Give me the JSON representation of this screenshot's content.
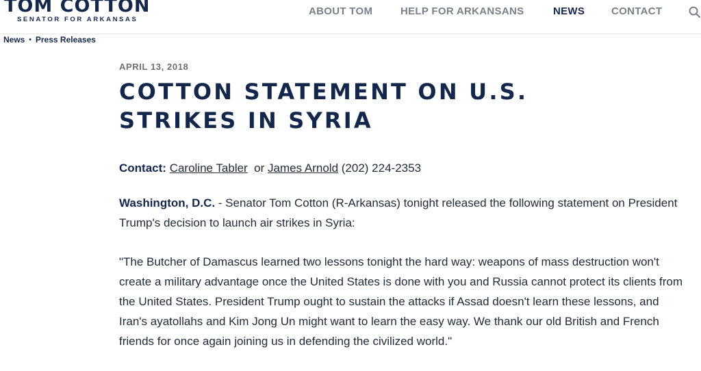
{
  "header": {
    "logo_name": "TOM COTTON",
    "logo_subtitle": "SENATOR FOR ARKANSAS",
    "nav": {
      "about": "ABOUT TOM",
      "help": "HELP FOR ARKANSANS",
      "news": "NEWS",
      "contact": "CONTACT"
    },
    "search_icon": "search-icon"
  },
  "breadcrumb": {
    "items": [
      "News",
      "Press Releases"
    ],
    "separator": "•"
  },
  "article": {
    "date": "APRIL 13, 2018",
    "title": "COTTON STATEMENT ON U.S. STRIKES IN SYRIA",
    "contact": {
      "label": "Contact:",
      "person1": "Caroline Tabler",
      "or": "or",
      "person2": "James Arnold",
      "phone": "(202) 224-2353"
    },
    "dateline": "Washington, D.C.",
    "intro": " - Senator Tom Cotton (R-Arkansas) tonight released the following statement on President Trump's decision to launch air strikes in Syria:",
    "quote": "\"The Butcher of Damascus learned two lessons tonight the hard way: weapons of mass destruction won't create a military advantage once the United States is done with you and Russia cannot protect its clients from the United States. President Trump ought to sustain the attacks if Assad doesn't learn these lessons, and Iran's ayatollahs and Kim Jong Un might want to learn the easy way. We thank our old British and French friends for once again joining us in defending the civilized world.\""
  },
  "colors": {
    "navy": "#14264a",
    "nav_gray": "#7a808a",
    "body_text": "#222b3a"
  }
}
